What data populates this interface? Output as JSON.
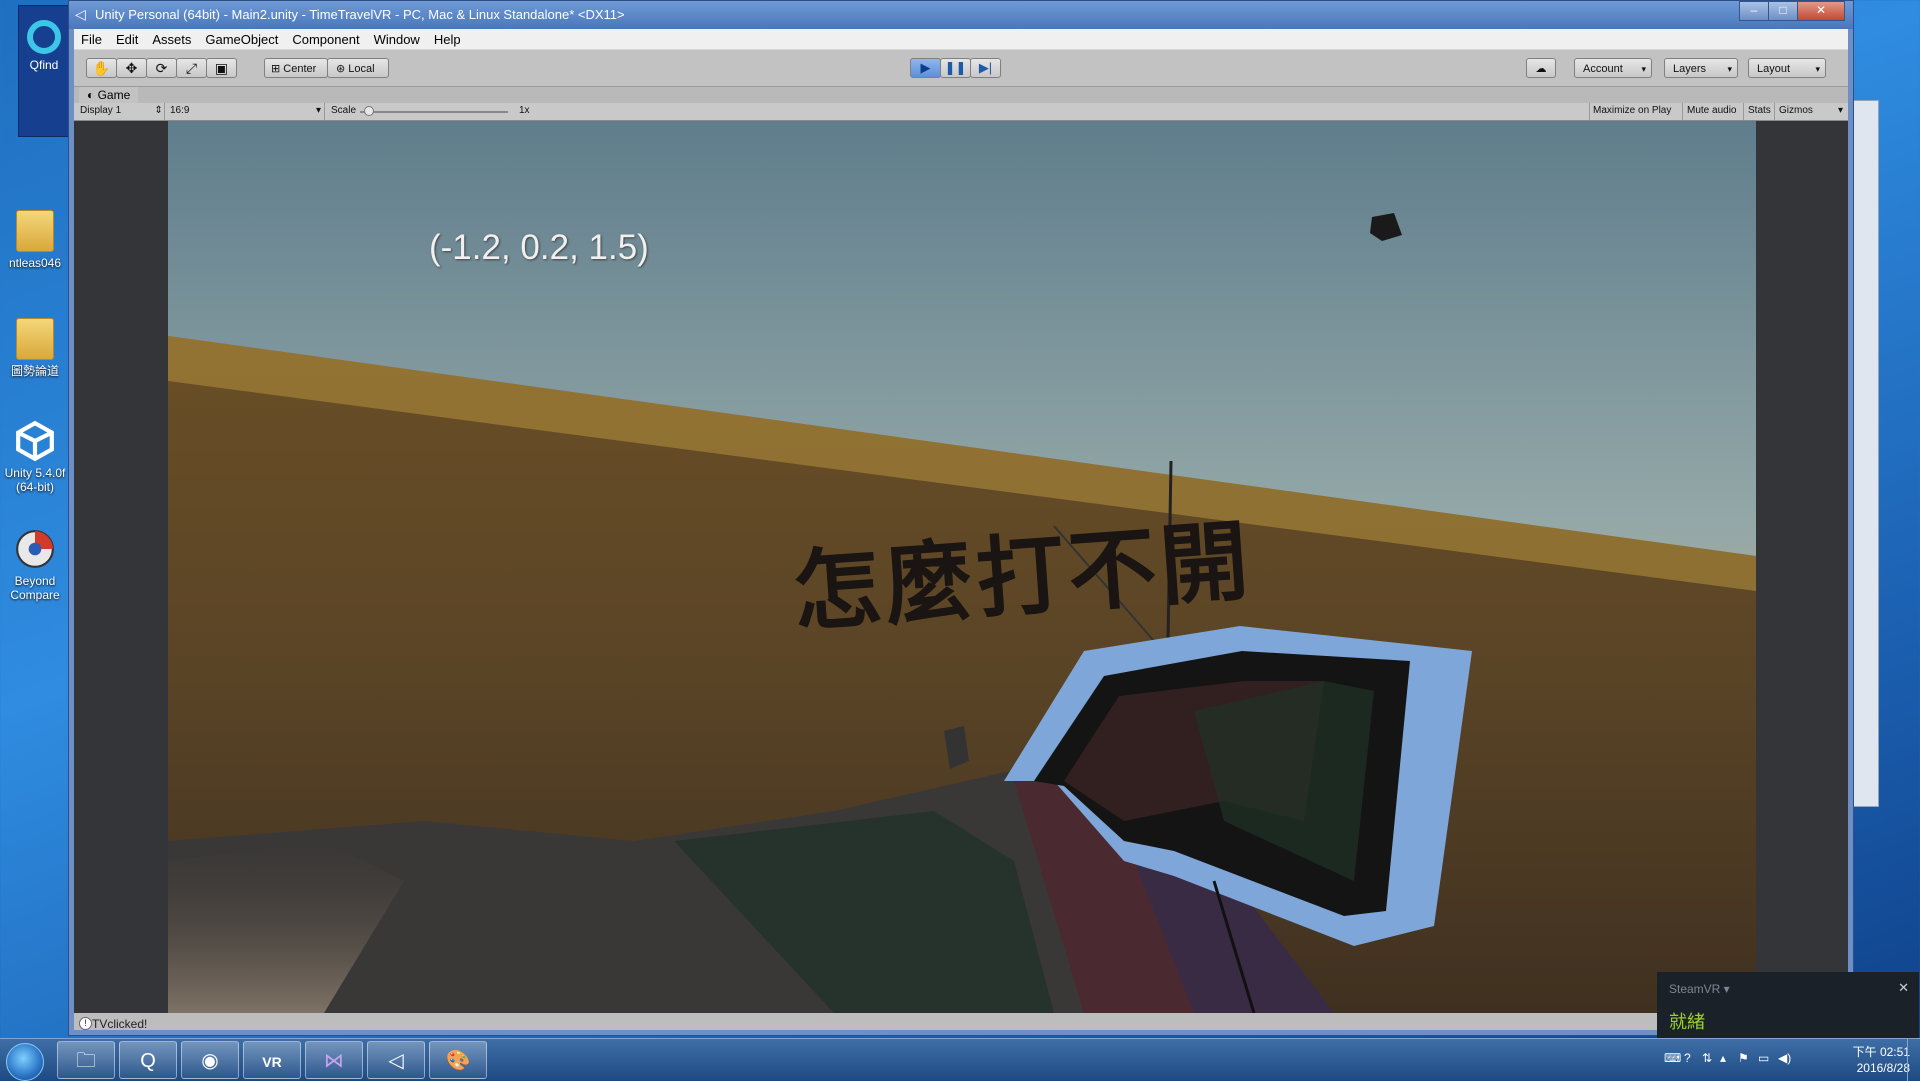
{
  "desktop": {
    "icons": [
      {
        "label": "Qfind",
        "icon": "qfind-icon"
      },
      {
        "label": "ntleas046",
        "icon": "folder-icon"
      },
      {
        "label": "圖勢論道",
        "icon": "folder-icon"
      },
      {
        "label": "Unity 5.4.0f (64-bit)",
        "icon": "unity-icon"
      },
      {
        "label": "Beyond Compare",
        "icon": "beyond-compare-icon"
      }
    ]
  },
  "window": {
    "title": "Unity Personal (64bit) - Main2.unity - TimeTravelVR - PC, Mac & Linux Standalone* <DX11>",
    "minimize": "–",
    "maximize": "□",
    "close": "✕"
  },
  "menu": [
    "File",
    "Edit",
    "Assets",
    "GameObject",
    "Component",
    "Window",
    "Help"
  ],
  "toolbar": {
    "tools": [
      "hand-tool-icon",
      "move-tool-icon",
      "rotate-tool-icon",
      "scale-tool-icon",
      "rect-tool-icon"
    ],
    "pivot": "Center",
    "space": "Local",
    "play_state": "playing",
    "account": "Account",
    "layers": "Layers",
    "layout": "Layout"
  },
  "game_tab": {
    "label": "Game",
    "display": "Display 1",
    "aspect": "16:9",
    "scale_label": "Scale",
    "scale_value": "1x",
    "maximize_on_play": "Maximize on Play",
    "mute_audio": "Mute audio",
    "stats": "Stats",
    "gizmos": "Gizmos"
  },
  "scene": {
    "coordinates": "(-1.2, 0.2, 1.5)",
    "handwriting": "怎麼打不開"
  },
  "status": {
    "message": "TVclicked!"
  },
  "steamvr": {
    "title": "SteamVR ▾",
    "status": "就緒",
    "close": "✕"
  },
  "taskbar": {
    "apps": [
      "explorer-icon",
      "qfind-icon",
      "chrome-icon",
      "vr-icon",
      "visual-studio-icon",
      "unity-icon",
      "paint-icon"
    ],
    "time": "下午 02:51",
    "date": "2016/8/28"
  },
  "colors": {
    "titlebar": "#4a77bb",
    "editor_bg": "#c2c2c2",
    "sky_top": "#5f7d8c",
    "ground": "#5a4426",
    "steam_ok": "#9bd12a"
  }
}
